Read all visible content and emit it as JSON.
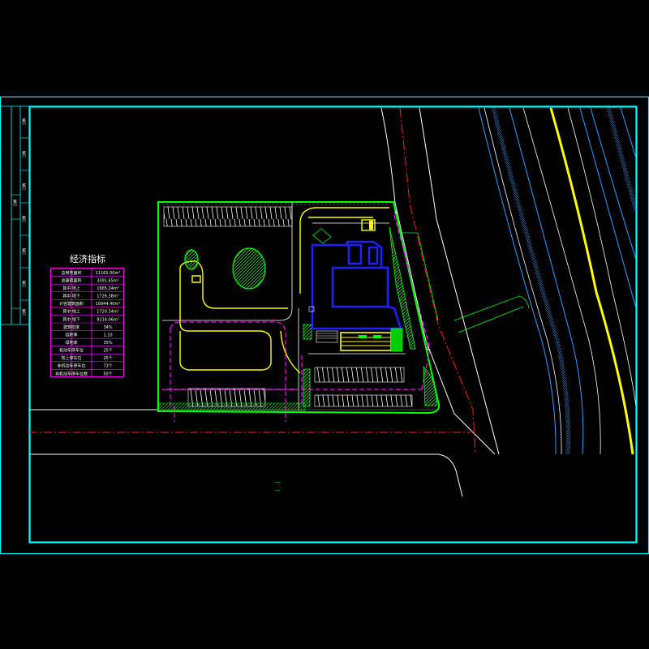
{
  "drawing": {
    "table_title": "经济指标",
    "table_rows": [
      {
        "label": "总用地面积",
        "value": "11165.00m²"
      },
      {
        "label": "总建筑面积",
        "value": "3391.65m²"
      },
      {
        "label": "其中 地上",
        "value": "1665.24m²"
      },
      {
        "label": "其中 地下",
        "value": "1726.38m²"
      },
      {
        "label": "计容建筑面积",
        "value": "10944.40m²"
      },
      {
        "label": "其中 地上",
        "value": "1720.34m²"
      },
      {
        "label": "其中 地下",
        "value": "9214.06m²"
      },
      {
        "label": "建筑密度",
        "value": "34%"
      },
      {
        "label": "容积率",
        "value": "1.10"
      },
      {
        "label": "绿地率",
        "value": "35%"
      },
      {
        "label": "机动车停车位",
        "value": "25个"
      },
      {
        "label": "地上停车位",
        "value": "25个"
      },
      {
        "label": "非机动车停车位",
        "value": "73个"
      },
      {
        "label": "非机动车停车位数",
        "value": "50个"
      }
    ],
    "side_labels": [
      "日期",
      "日期",
      "日期",
      "日期",
      "日期",
      "日期",
      "日期",
      "日期"
    ],
    "markers": [
      "4",
      "4"
    ],
    "colors": {
      "frame": "#00ffff",
      "site_boundary": "#00ff00",
      "road_centerline": "#ff2020",
      "fire_lane": "#ff00ff",
      "building": "#2020ff",
      "landscape": "#ffff00",
      "road_edge": "#ffffff",
      "road_lane": "#2aa0ff",
      "road_accent": "#ffff00"
    }
  }
}
